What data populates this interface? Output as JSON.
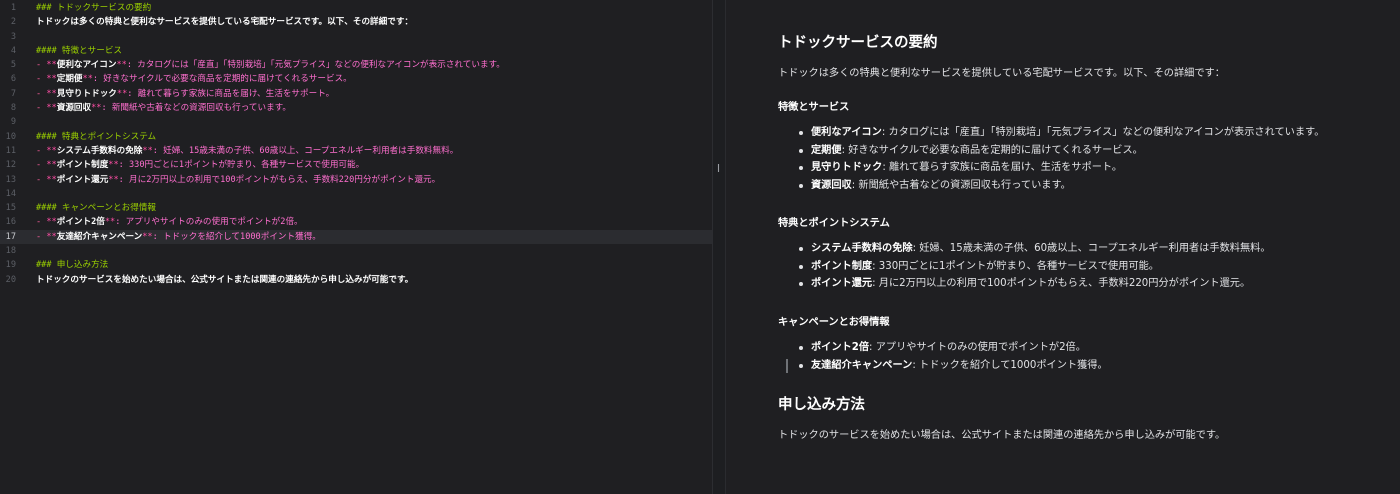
{
  "editor": {
    "lines": [
      {
        "n": "1",
        "segs": [
          {
            "t": "### トドックサービスの要約",
            "c": "tk-h"
          }
        ]
      },
      {
        "n": "2",
        "segs": [
          {
            "t": "トドックは多くの特典と便利なサービスを提供している宅配サービスです。以下、その詳細です：",
            "c": "tk-plain"
          }
        ]
      },
      {
        "n": "3",
        "segs": []
      },
      {
        "n": "4",
        "segs": [
          {
            "t": "#### 特徴とサービス",
            "c": "tk-h"
          }
        ]
      },
      {
        "n": "5",
        "segs": [
          {
            "t": "- ",
            "c": "tk-dash"
          },
          {
            "t": "**",
            "c": "tk-star"
          },
          {
            "t": "便利なアイコン",
            "c": "tk-bold"
          },
          {
            "t": "**",
            "c": "tk-star"
          },
          {
            "t": ": カタログには「産直」「特別栽培」「元気プライス」などの便利なアイコンが表示されています。",
            "c": "tk-pink"
          }
        ]
      },
      {
        "n": "6",
        "segs": [
          {
            "t": "- ",
            "c": "tk-dash"
          },
          {
            "t": "**",
            "c": "tk-star"
          },
          {
            "t": "定期便",
            "c": "tk-bold"
          },
          {
            "t": "**",
            "c": "tk-star"
          },
          {
            "t": ": 好きなサイクルで必要な商品を定期的に届けてくれるサービス。",
            "c": "tk-pink"
          }
        ]
      },
      {
        "n": "7",
        "segs": [
          {
            "t": "- ",
            "c": "tk-dash"
          },
          {
            "t": "**",
            "c": "tk-star"
          },
          {
            "t": "見守りトドック",
            "c": "tk-bold"
          },
          {
            "t": "**",
            "c": "tk-star"
          },
          {
            "t": ": 離れて暮らす家族に商品を届け、生活をサポート。",
            "c": "tk-pink"
          }
        ]
      },
      {
        "n": "8",
        "segs": [
          {
            "t": "- ",
            "c": "tk-dash"
          },
          {
            "t": "**",
            "c": "tk-star"
          },
          {
            "t": "資源回収",
            "c": "tk-bold"
          },
          {
            "t": "**",
            "c": "tk-star"
          },
          {
            "t": ": 新聞紙や古着などの資源回収も行っています。",
            "c": "tk-pink"
          }
        ]
      },
      {
        "n": "9",
        "segs": []
      },
      {
        "n": "10",
        "segs": [
          {
            "t": "#### 特典とポイントシステム",
            "c": "tk-h"
          }
        ]
      },
      {
        "n": "11",
        "segs": [
          {
            "t": "- ",
            "c": "tk-dash"
          },
          {
            "t": "**",
            "c": "tk-star"
          },
          {
            "t": "システム手数料の免除",
            "c": "tk-bold"
          },
          {
            "t": "**",
            "c": "tk-star"
          },
          {
            "t": ": 妊婦、15歳未満の子供、60歳以上、コープエネルギー利用者は手数料無料。",
            "c": "tk-pink"
          }
        ]
      },
      {
        "n": "12",
        "segs": [
          {
            "t": "- ",
            "c": "tk-dash"
          },
          {
            "t": "**",
            "c": "tk-star"
          },
          {
            "t": "ポイント制度",
            "c": "tk-bold"
          },
          {
            "t": "**",
            "c": "tk-star"
          },
          {
            "t": ": 330円ごとに1ポイントが貯まり、各種サービスで使用可能。",
            "c": "tk-pink"
          }
        ]
      },
      {
        "n": "13",
        "segs": [
          {
            "t": "- ",
            "c": "tk-dash"
          },
          {
            "t": "**",
            "c": "tk-star"
          },
          {
            "t": "ポイント還元",
            "c": "tk-bold"
          },
          {
            "t": "**",
            "c": "tk-star"
          },
          {
            "t": ": 月に2万円以上の利用で100ポイントがもらえ、手数料220円分がポイント還元。",
            "c": "tk-pink"
          }
        ]
      },
      {
        "n": "14",
        "segs": []
      },
      {
        "n": "15",
        "segs": [
          {
            "t": "#### キャンペーンとお得情報",
            "c": "tk-h"
          }
        ]
      },
      {
        "n": "16",
        "segs": [
          {
            "t": "- ",
            "c": "tk-dash"
          },
          {
            "t": "**",
            "c": "tk-star"
          },
          {
            "t": "ポイント2倍",
            "c": "tk-bold"
          },
          {
            "t": "**",
            "c": "tk-star"
          },
          {
            "t": ": アプリやサイトのみの使用でポイントが2倍。",
            "c": "tk-pink"
          }
        ]
      },
      {
        "n": "17",
        "current": true,
        "segs": [
          {
            "t": "- ",
            "c": "tk-dash"
          },
          {
            "t": "**",
            "c": "tk-star"
          },
          {
            "t": "友達紹介キャンペーン",
            "c": "tk-bold"
          },
          {
            "t": "**",
            "c": "tk-star"
          },
          {
            "t": ": トドックを紹介して1000ポイント獲得。",
            "c": "tk-pink"
          }
        ]
      },
      {
        "n": "18",
        "segs": []
      },
      {
        "n": "19",
        "segs": [
          {
            "t": "### 申し込み方法",
            "c": "tk-h"
          }
        ]
      },
      {
        "n": "20",
        "segs": [
          {
            "t": "トドックのサービスを始めたい場合は、公式サイトまたは関連の連絡先から申し込みが可能です。",
            "c": "tk-plain"
          }
        ]
      }
    ]
  },
  "divider": {
    "cursor_glyph": "Ⅰ"
  },
  "preview": {
    "title": "トドックサービスの要約",
    "intro": "トドックは多くの特典と便利なサービスを提供している宅配サービスです。以下、その詳細です：",
    "sections": [
      {
        "heading": "特徴とサービス",
        "items": [
          {
            "b": "便利なアイコン",
            "t": ": カタログには「産直」「特別栽培」「元気プライス」などの便利なアイコンが表示されています。"
          },
          {
            "b": "定期便",
            "t": ": 好きなサイクルで必要な商品を定期的に届けてくれるサービス。"
          },
          {
            "b": "見守りトドック",
            "t": ": 離れて暮らす家族に商品を届け、生活をサポート。"
          },
          {
            "b": "資源回収",
            "t": ": 新聞紙や古着などの資源回収も行っています。"
          }
        ]
      },
      {
        "heading": "特典とポイントシステム",
        "items": [
          {
            "b": "システム手数料の免除",
            "t": ": 妊婦、15歳未満の子供、60歳以上、コープエネルギー利用者は手数料無料。"
          },
          {
            "b": "ポイント制度",
            "t": ": 330円ごとに1ポイントが貯まり、各種サービスで使用可能。"
          },
          {
            "b": "ポイント還元",
            "t": ": 月に2万円以上の利用で100ポイントがもらえ、手数料220円分がポイント還元。"
          }
        ]
      },
      {
        "heading": "キャンペーンとお得情報",
        "items": [
          {
            "b": "ポイント2倍",
            "t": ": アプリやサイトのみの使用でポイントが2倍。"
          },
          {
            "b": "友達紹介キャンペーン",
            "t": ": トドックを紹介して1000ポイント獲得。",
            "active": true
          }
        ]
      }
    ],
    "apply_heading": "申し込み方法",
    "apply_text": "トドックのサービスを始めたい場合は、公式サイトまたは関連の連絡先から申し込みが可能です。"
  },
  "colors": {
    "heading_green": "#9bd000",
    "markdown_pink": "#ff6fcf",
    "background": "#1f1f22",
    "current_line": "#2b2c30"
  }
}
